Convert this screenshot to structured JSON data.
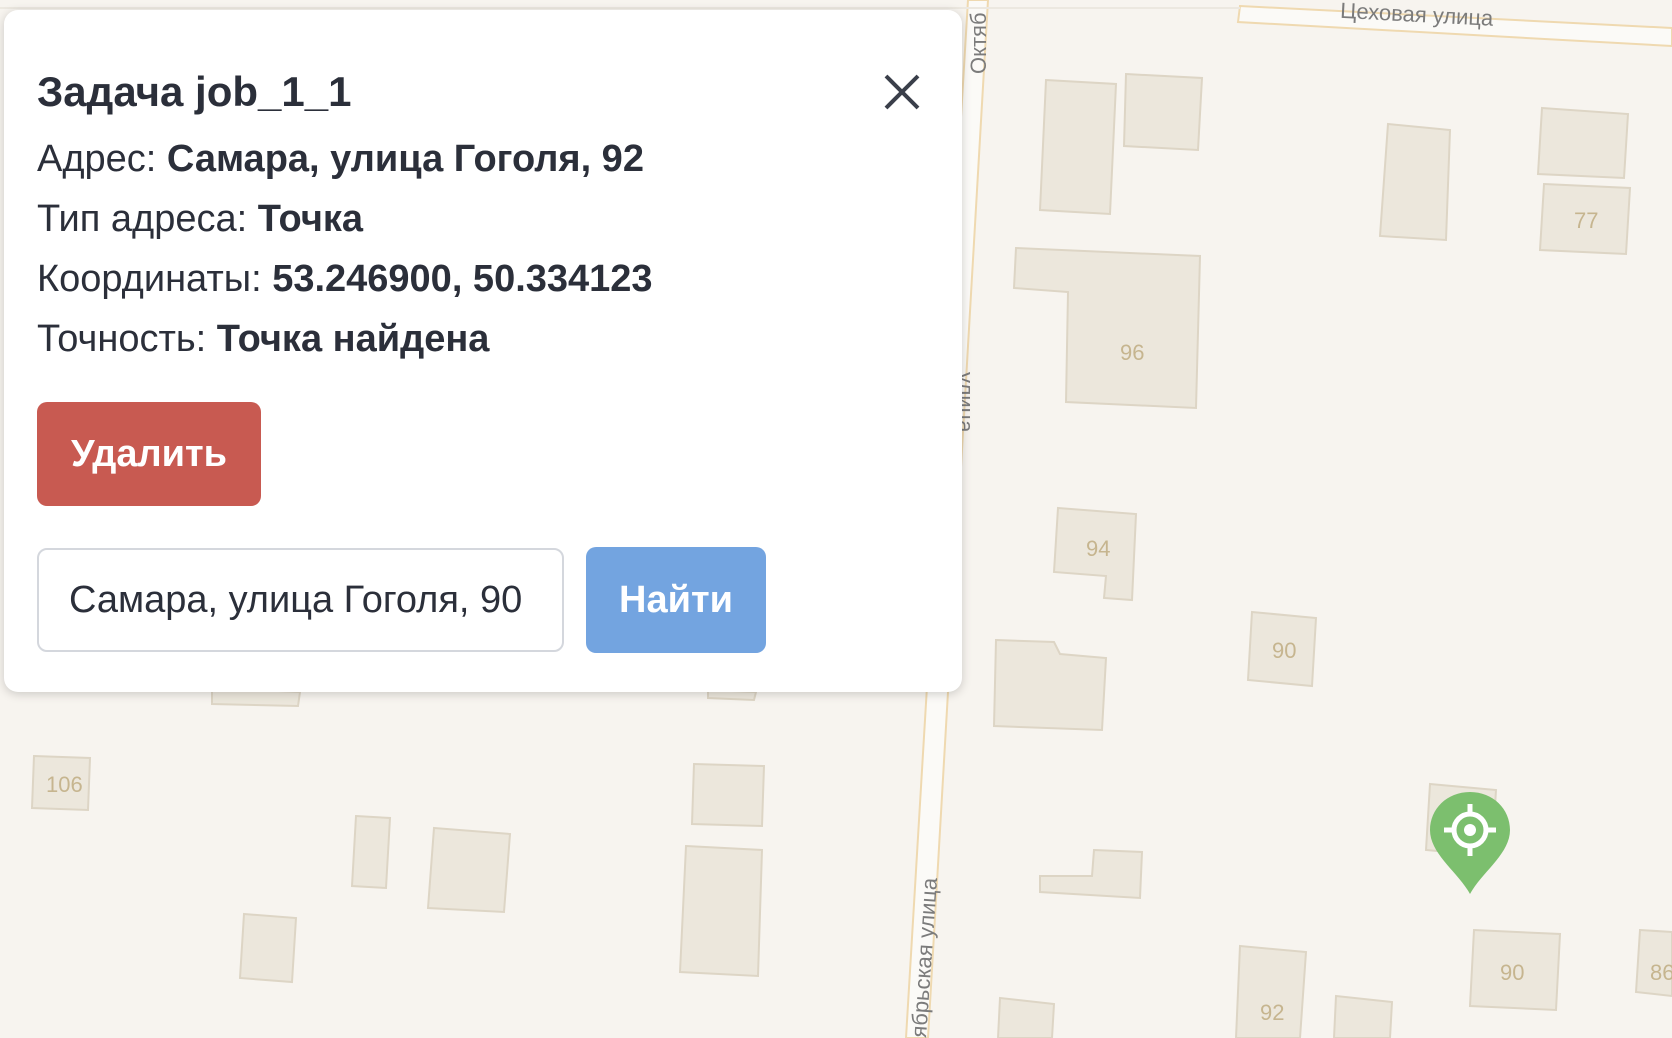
{
  "map": {
    "street_top": "Цеховая улица",
    "street_vertical_top": "Октяб",
    "street_vertical_mid": "улица",
    "street_vertical_bottom": "ябрьская улица",
    "house_numbers": [
      "106",
      "96",
      "94",
      "90",
      "77",
      "90",
      "92",
      "86"
    ]
  },
  "popup": {
    "title": "Задача job_1_1",
    "address_label": "Адрес: ",
    "address_value": "Самара, улица Гоголя, 92",
    "address_type_label": "Тип адреса: ",
    "address_type_value": "Точка",
    "coords_label": "Координаты: ",
    "coords_value": "53.246900, 50.334123",
    "accuracy_label": "Точность: ",
    "accuracy_value": "Точка найдена",
    "delete_label": "Удалить",
    "search_value": "Самара, улица Гоголя, 90",
    "find_label": "Найти"
  },
  "colors": {
    "delete": "#c85a51",
    "find": "#73a4e0",
    "pin": "#7cbf6e",
    "map_bg": "#f7f4ef",
    "building": "#ece7dc"
  },
  "icons": {
    "close": "close-icon",
    "pin": "location-pin-icon"
  }
}
